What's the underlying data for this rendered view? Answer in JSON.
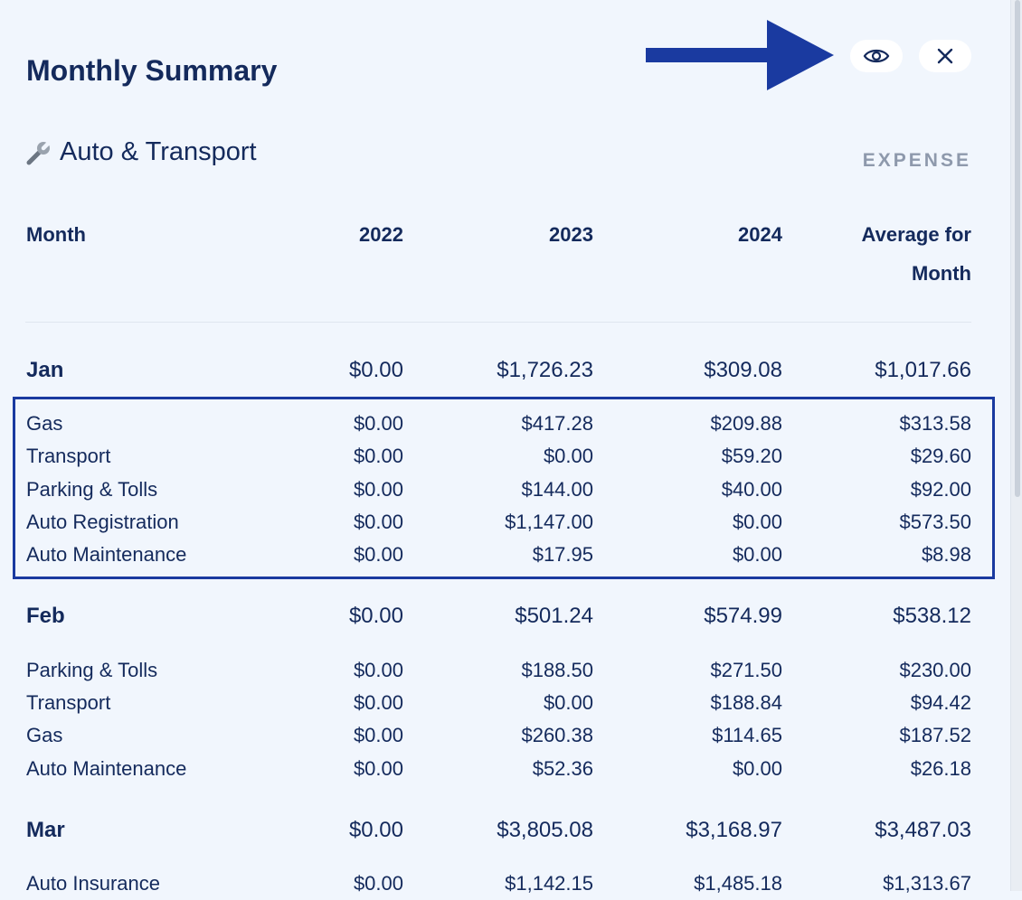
{
  "header": {
    "title": "Monthly Summary",
    "icons": {
      "view": "eye-icon",
      "close": "close-icon",
      "annotation": "arrow-right-icon"
    }
  },
  "category": {
    "icon": "wrench-icon",
    "name": "Auto & Transport",
    "type": "EXPENSE"
  },
  "table": {
    "columns": [
      "Month",
      "2022",
      "2023",
      "2024",
      "Average for Month"
    ],
    "groups": [
      {
        "month": {
          "label": "Jan",
          "values": [
            "$0.00",
            "$1,726.23",
            "$309.08",
            "$1,017.66"
          ]
        },
        "items": [
          {
            "label": "Gas",
            "values": [
              "$0.00",
              "$417.28",
              "$209.88",
              "$313.58"
            ]
          },
          {
            "label": "Transport",
            "values": [
              "$0.00",
              "$0.00",
              "$59.20",
              "$29.60"
            ]
          },
          {
            "label": "Parking & Tolls",
            "values": [
              "$0.00",
              "$144.00",
              "$40.00",
              "$92.00"
            ]
          },
          {
            "label": "Auto Registration",
            "values": [
              "$0.00",
              "$1,147.00",
              "$0.00",
              "$573.50"
            ]
          },
          {
            "label": "Auto Maintenance",
            "values": [
              "$0.00",
              "$17.95",
              "$0.00",
              "$8.98"
            ]
          }
        ]
      },
      {
        "month": {
          "label": "Feb",
          "values": [
            "$0.00",
            "$501.24",
            "$574.99",
            "$538.12"
          ]
        },
        "items": [
          {
            "label": "Parking & Tolls",
            "values": [
              "$0.00",
              "$188.50",
              "$271.50",
              "$230.00"
            ]
          },
          {
            "label": "Transport",
            "values": [
              "$0.00",
              "$0.00",
              "$188.84",
              "$94.42"
            ]
          },
          {
            "label": "Gas",
            "values": [
              "$0.00",
              "$260.38",
              "$114.65",
              "$187.52"
            ]
          },
          {
            "label": "Auto Maintenance",
            "values": [
              "$0.00",
              "$52.36",
              "$0.00",
              "$26.18"
            ]
          }
        ]
      },
      {
        "month": {
          "label": "Mar",
          "values": [
            "$0.00",
            "$3,805.08",
            "$3,168.97",
            "$3,487.03"
          ]
        },
        "items": [
          {
            "label": "Auto Insurance",
            "values": [
              "$0.00",
              "$1,142.15",
              "$1,485.18",
              "$1,313.67"
            ]
          }
        ]
      }
    ]
  },
  "colors": {
    "background": "#f1f6fd",
    "text": "#142a5c",
    "muted": "#8e99ac",
    "highlight": "#1a3aa0"
  }
}
